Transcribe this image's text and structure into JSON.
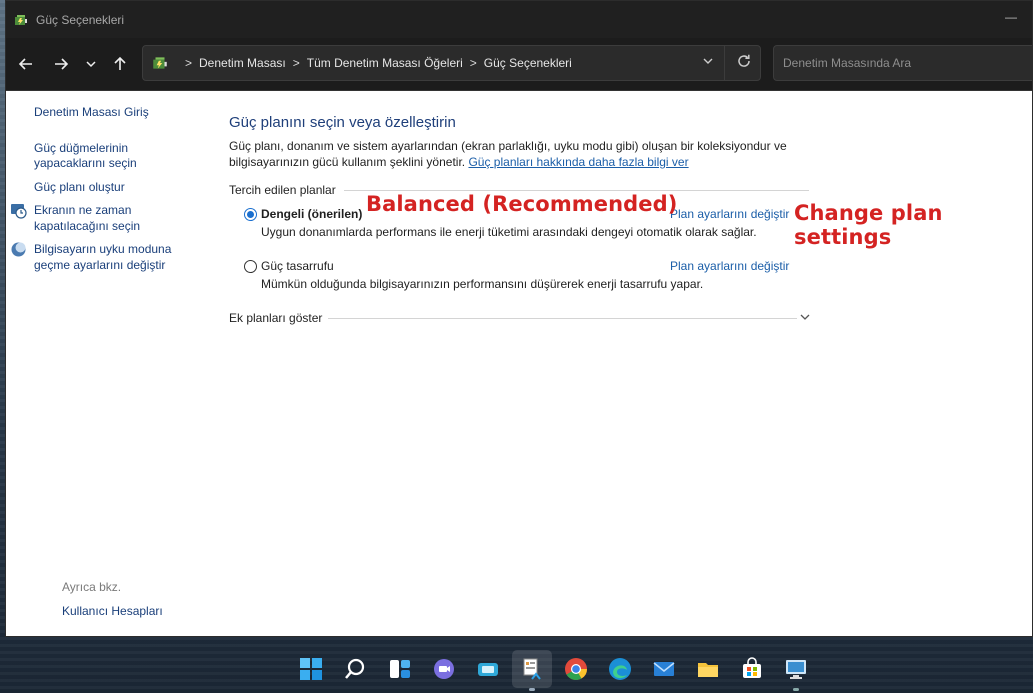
{
  "window": {
    "title": "Güç Seçenekleri"
  },
  "address": {
    "crumbs": [
      "Denetim Masası",
      "Tüm Denetim Masası Öğeleri",
      "Güç Seçenekleri"
    ],
    "sep": ">"
  },
  "search": {
    "placeholder": "Denetim Masasında Ara"
  },
  "sidebar": {
    "items": [
      {
        "label": "Denetim Masası Giriş"
      },
      {
        "label": "Güç düğmelerinin yapacaklarını seçin"
      },
      {
        "label": "Güç planı oluştur"
      },
      {
        "label": "Ekranın ne zaman kapatılacağını seçin"
      },
      {
        "label": "Bilgisayarın uyku moduna geçme ayarlarını değiştir"
      }
    ],
    "see_also": "Ayrıca bkz.",
    "users": "Kullanıcı Hesapları"
  },
  "main": {
    "title": "Güç planını seçin veya özelleştirin",
    "desc": "Güç planı, donanım ve sistem ayarlarından (ekran parlaklığı, uyku modu gibi) oluşan bir koleksiyondur ve bilgisayarınızın gücü kullanım şeklini yönetir.",
    "desc_link": "Güç planları hakkında daha fazla bilgi ver",
    "group_label": "Tercih edilen planlar",
    "plans": [
      {
        "name": "Dengeli (önerilen)",
        "change": "Plan ayarlarını değiştir",
        "desc": "Uygun donanımlarda performans ile enerji tüketimi arasındaki dengeyi otomatik olarak sağlar.",
        "selected": true
      },
      {
        "name": "Güç tasarrufu",
        "change": "Plan ayarlarını değiştir",
        "desc": "Mümkün olduğunda bilgisayarınızın performansını düşürerek enerji tasarrufu yapar.",
        "selected": false
      }
    ],
    "extra": "Ek planları göster"
  },
  "annotations": {
    "balanced": "Balanced (Recommended)",
    "change": "Change plan settings",
    "color": "#d42322"
  },
  "taskbar": {
    "icons": [
      "windows-start-icon",
      "search-icon",
      "widgets-icon",
      "teams-chat-icon",
      "snip-icon",
      "control-panel-icon",
      "chrome-icon",
      "edge-icon",
      "mail-icon",
      "file-explorer-icon",
      "store-icon",
      "remote-desktop-icon"
    ]
  }
}
